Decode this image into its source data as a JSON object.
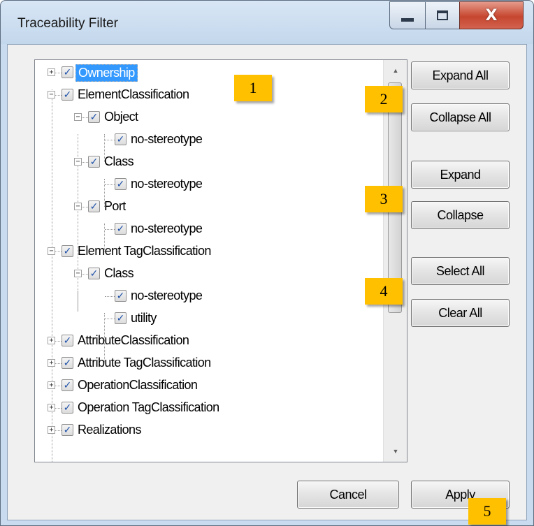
{
  "window": {
    "title": "Traceability Filter",
    "close_glyph": "X"
  },
  "tree": {
    "items": [
      {
        "label": "Ownership",
        "checked": true,
        "expander": "+",
        "selected": true
      },
      {
        "label": "ElementClassification",
        "checked": true,
        "expander": "−"
      },
      {
        "label": "Object",
        "checked": true,
        "expander": "−"
      },
      {
        "label": "no-stereotype",
        "checked": true
      },
      {
        "label": "Class",
        "checked": true,
        "expander": "−"
      },
      {
        "label": "no-stereotype",
        "checked": true
      },
      {
        "label": "Port",
        "checked": true,
        "expander": "−"
      },
      {
        "label": "no-stereotype",
        "checked": true
      },
      {
        "label": "Element TagClassification",
        "checked": true,
        "expander": "−"
      },
      {
        "label": "Class",
        "checked": true,
        "expander": "−"
      },
      {
        "label": "no-stereotype",
        "checked": true
      },
      {
        "label": "utility",
        "checked": true
      },
      {
        "label": "AttributeClassification",
        "checked": true,
        "expander": "+"
      },
      {
        "label": "Attribute TagClassification",
        "checked": true,
        "expander": "+"
      },
      {
        "label": "OperationClassification",
        "checked": true,
        "expander": "+"
      },
      {
        "label": "Operation TagClassification",
        "checked": true,
        "expander": "+"
      },
      {
        "label": "Realizations",
        "checked": true,
        "expander": "+"
      }
    ],
    "check_glyph": "✓"
  },
  "buttons": {
    "expand_all": "Expand All",
    "collapse_all": "Collapse All",
    "expand": "Expand",
    "collapse": "Collapse",
    "select_all": "Select All",
    "clear_all": "Clear All",
    "cancel": "Cancel",
    "apply": "Apply"
  },
  "callouts": [
    "1",
    "2",
    "3",
    "4",
    "5"
  ],
  "colors": {
    "callout": "#ffc000",
    "selection": "#3399ff",
    "checkmark": "#1c4fa8"
  }
}
